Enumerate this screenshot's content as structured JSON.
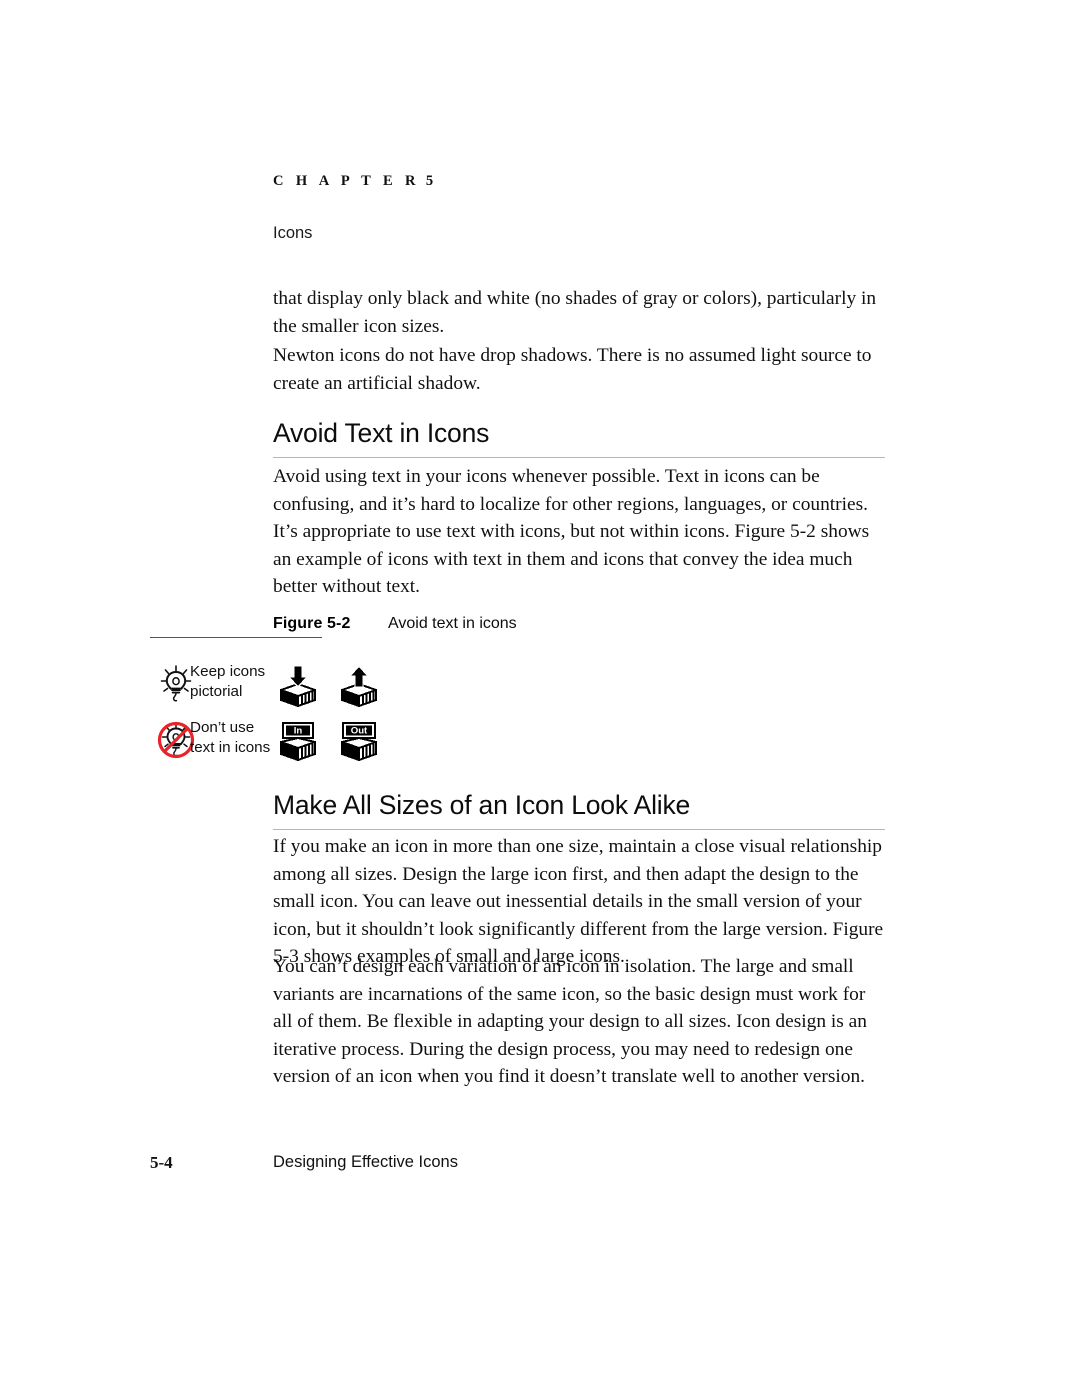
{
  "header": {
    "chapter_word": "C H A P T E R",
    "chapter_number": "5",
    "running_head": "Icons"
  },
  "body": {
    "paragraph_1": "that display only black and white (no shades of gray or colors), particularly in the smaller icon sizes.",
    "paragraph_2": "Newton icons do not have drop shadows. There is no assumed light source to create an artificial shadow.",
    "paragraph_3": "Avoid using text in your icons whenever possible. Text in icons can be confusing, and it’s hard to localize for other regions, languages, or countries. It’s appropriate to use text with icons, but not within icons. Figure 5-2 shows an example of icons with text in them and icons that convey the idea much better without text.",
    "paragraph_4": "If you make an icon in more than one size, maintain a close visual relationship among all sizes. Design the large icon first, and then adapt the design to the small icon. You can leave out inessential details in the small version of your icon, but it shouldn’t look significantly different from the large version. Figure 5-3 shows examples of small and large icons.",
    "paragraph_5": "You can’t design each variation of an icon in isolation. The large and small variants are incarnations of the same icon, so the basic design must work for all of them. Be flexible in adapting your design to all sizes. Icon design is an iterative process. During the design process, you may need to redesign one version of an icon when you find it doesn’t translate well to another version."
  },
  "sections": [
    {
      "heading": "Avoid Text in Icons"
    },
    {
      "heading": "Make All Sizes of an Icon Look Alike"
    }
  ],
  "figure": {
    "label": "Figure 5-2",
    "title": "Avoid text in icons",
    "rows": [
      {
        "marker_icon": "lightbulb-icon",
        "label": "Keep icons\npictorial",
        "icons": [
          {
            "name": "inbox-tray-down-arrow-icon",
            "text": ""
          },
          {
            "name": "outbox-tray-up-arrow-icon",
            "text": ""
          }
        ]
      },
      {
        "marker_icon": "no-lightbulb-prohibited-icon",
        "label": "Don’t use\ntext in icons",
        "icons": [
          {
            "name": "inbox-tray-text-label-icon",
            "text": "In"
          },
          {
            "name": "outbox-tray-text-label-icon",
            "text": "Out"
          }
        ]
      }
    ]
  },
  "footer": {
    "folio": "5-4",
    "title": "Designing Effective Icons"
  },
  "colors": {
    "text": "#111111",
    "rule": "#b7b7b7",
    "figure_rule": "#555555",
    "prohibition_red": "#e8232a"
  }
}
